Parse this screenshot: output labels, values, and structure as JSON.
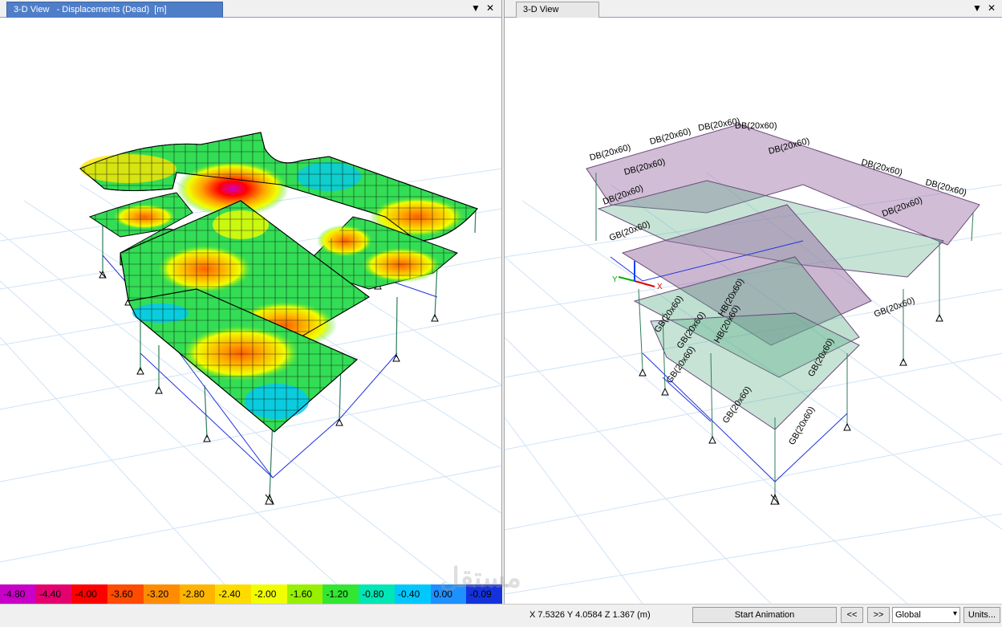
{
  "left_pane": {
    "tab_title": "3-D View   - Displacements (Dead)  [m]",
    "dropdown_glyph": "▼",
    "close_glyph": "✕"
  },
  "right_pane": {
    "tab_title": "3-D View",
    "dropdown_glyph": "▼",
    "close_glyph": "✕",
    "axis_labels": {
      "y": "Y",
      "x": "X"
    },
    "beam_labels": [
      "DB(20x60)",
      "DB(20x60)",
      "DB(20x60)",
      "DB(20x60)",
      "DB(20x60)",
      "DB(20x60)",
      "DB(20x60)",
      "DB(20x60)",
      "DB(20x60)",
      "DB(20x60)",
      "GB(20x60)",
      "GB(20x60)",
      "GB(20x60)",
      "GB(20x60)",
      "GB(20x60)",
      "GB(20x60)",
      "GB(20x60)",
      "GB(20x60)",
      "HB(20x60)",
      "HB(20x60)"
    ]
  },
  "legend": {
    "values": [
      "-4.80",
      "-4.40",
      "-4.00",
      "-3.60",
      "-3.20",
      "-2.80",
      "-2.40",
      "-2.00",
      "-1.60",
      "-1.20",
      "-0.80",
      "-0.40",
      "0.00",
      "-0.09"
    ],
    "colors": [
      "#c800c8",
      "#e6006e",
      "#ff0000",
      "#ff4b00",
      "#ff8c00",
      "#ffb400",
      "#ffdc00",
      "#f0ff00",
      "#96f000",
      "#32e632",
      "#00e6b4",
      "#00c8ff",
      "#1e90ff",
      "#1432dc"
    ]
  },
  "status": {
    "coordinates": "X 7.5326  Y 4.0584  Z 1.367 (m)",
    "animation_label": "Start Animation",
    "prev_label": "<<",
    "next_label": ">>",
    "coord_system": "Global",
    "units_label": "Units..."
  },
  "watermark": "مستقل"
}
